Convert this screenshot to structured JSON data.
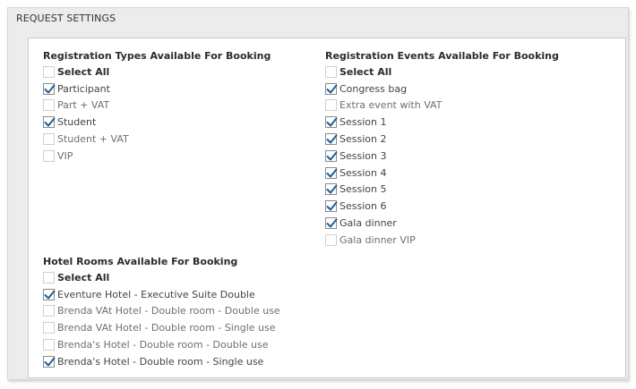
{
  "section_title": "REQUEST SETTINGS",
  "registration_types": {
    "title": "Registration Types Available For Booking",
    "select_all": "Select All",
    "items": [
      {
        "label": "Participant",
        "checked": true
      },
      {
        "label": "Part + VAT",
        "checked": false
      },
      {
        "label": "Student",
        "checked": true
      },
      {
        "label": "Student + VAT",
        "checked": false
      },
      {
        "label": "VIP",
        "checked": false
      }
    ]
  },
  "registration_events": {
    "title": "Registration Events Available For Booking",
    "select_all": "Select All",
    "items": [
      {
        "label": "Congress bag",
        "checked": true
      },
      {
        "label": "Extra event with VAT",
        "checked": false
      },
      {
        "label": "Session 1",
        "checked": true
      },
      {
        "label": "Session 2",
        "checked": true
      },
      {
        "label": "Session 3",
        "checked": true
      },
      {
        "label": "Session 4",
        "checked": true
      },
      {
        "label": "Session 5",
        "checked": true
      },
      {
        "label": "Session 6",
        "checked": true
      },
      {
        "label": "Gala dinner",
        "checked": true
      },
      {
        "label": "Gala dinner VIP",
        "checked": false
      }
    ]
  },
  "hotel_rooms": {
    "title": "Hotel Rooms Available For Booking",
    "select_all": "Select All",
    "items": [
      {
        "label": "Eventure Hotel - Executive Suite Double",
        "checked": true
      },
      {
        "label": "Brenda VAt Hotel - Double room - Double use",
        "checked": false
      },
      {
        "label": "Brenda VAt Hotel - Double room - Single use",
        "checked": false
      },
      {
        "label": "Brenda's Hotel - Double room - Double use",
        "checked": false
      },
      {
        "label": "Brenda's Hotel - Double room - Single use",
        "checked": true
      }
    ]
  },
  "colors": {
    "checkmark": "#1f5f9a",
    "panel_background": "#ececec",
    "inner_background": "#ffffff"
  }
}
